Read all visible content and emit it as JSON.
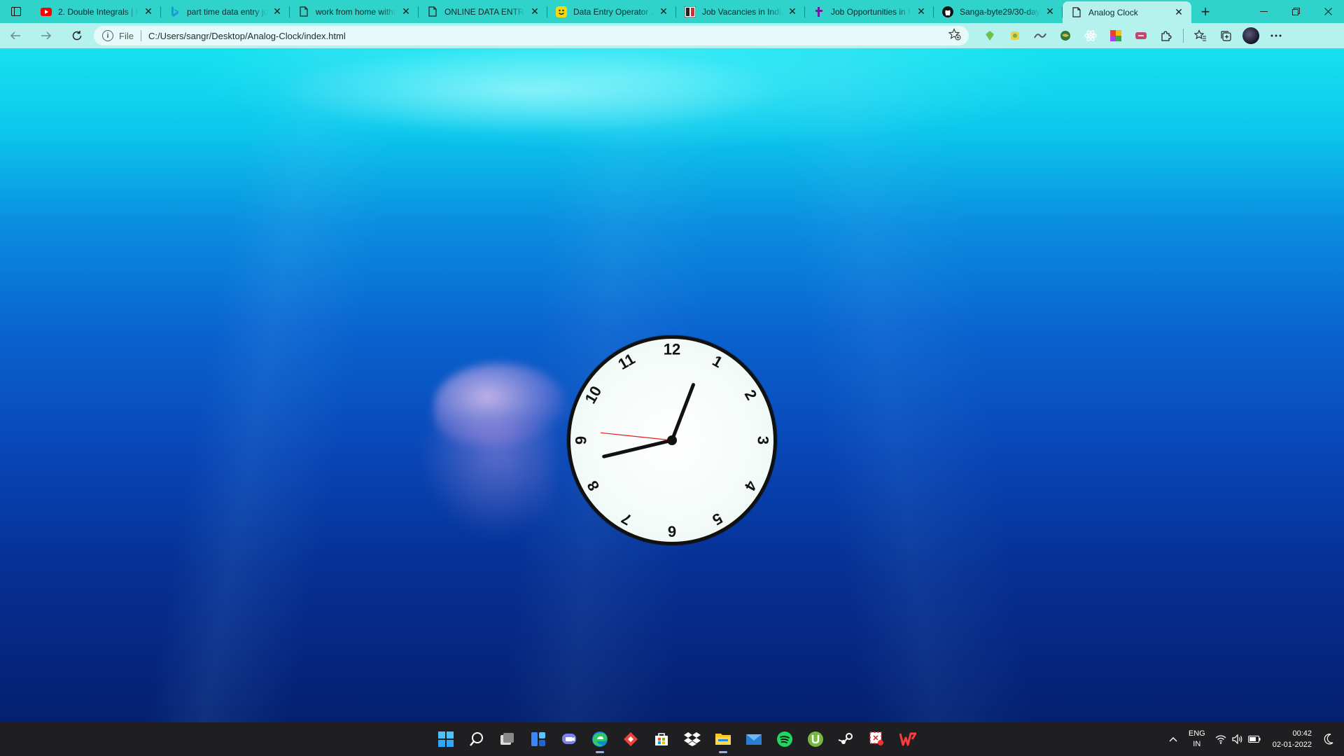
{
  "browser": {
    "tabs": [
      {
        "title": "2. Double Integrals | P",
        "favicon": "youtube-icon",
        "color": "#ff0000"
      },
      {
        "title": "part time data entry jo",
        "favicon": "bing-icon",
        "color": "#1a9bd7"
      },
      {
        "title": "work from home witho",
        "favicon": "page-icon",
        "color": "#333333"
      },
      {
        "title": "ONLINE DATA ENTRY",
        "favicon": "page-icon",
        "color": "#333333"
      },
      {
        "title": "Data Entry Operator Jo",
        "favicon": "smiley-icon",
        "color": "#f5d90a"
      },
      {
        "title": "Job Vacancies in India",
        "favicon": "timesjobs-icon",
        "color": "#d32f2f"
      },
      {
        "title": "Job Opportunities in In",
        "favicon": "apna-icon",
        "color": "#6b1fa0"
      },
      {
        "title": "Sanga-byte29/30-day",
        "favicon": "github-icon",
        "color": "#111111"
      },
      {
        "title": "Analog Clock",
        "favicon": "page-icon",
        "color": "#333333",
        "active": true
      }
    ],
    "new_tab_label": "+",
    "address": {
      "scheme_label": "File",
      "url": "C:/Users/sangr/Desktop/Analog-Clock/index.html"
    }
  },
  "clock": {
    "numbers": [
      "12",
      "1",
      "2",
      "3",
      "4",
      "5",
      "6",
      "7",
      "8",
      "9",
      "10",
      "11"
    ],
    "time": {
      "hours": 0,
      "minutes": 42,
      "seconds": 46
    }
  },
  "taskbar": {
    "apps": [
      "windows-start-icon",
      "search-icon",
      "task-view-icon",
      "widgets-icon",
      "teams-chat-icon",
      "edge-icon",
      "anydesk-icon",
      "store-icon",
      "dropbox-icon",
      "file-explorer-icon",
      "mail-icon",
      "spotify-icon",
      "utorrent-icon",
      "steam-icon",
      "snipping-tool-icon",
      "wps-office-icon"
    ],
    "language_top": "ENG",
    "language_bottom": "IN",
    "time": "00:42",
    "date": "02-01-2022"
  }
}
